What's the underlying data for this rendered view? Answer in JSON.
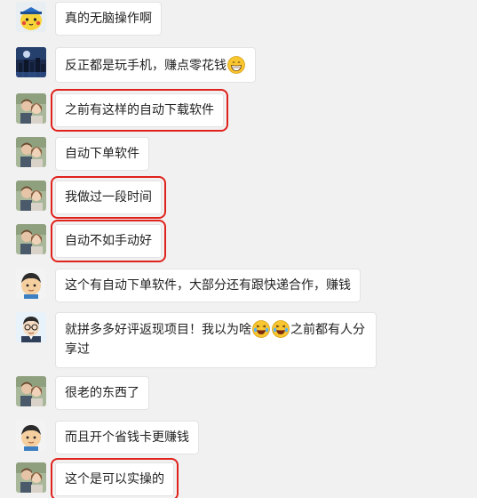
{
  "messages": [
    {
      "text": "真的无脑操作啊",
      "avatar": "pikachu-cap-avatar-icon",
      "highlighted": false
    },
    {
      "text": "反正都是玩手机，赚点零花钱",
      "avatar": "night-city-avatar-icon",
      "highlighted": false,
      "trailing_emoji": "grinning-face-emoji-icon"
    },
    {
      "text": "之前有这样的自动下载软件",
      "avatar": "couple-photo-avatar-icon",
      "highlighted": true
    },
    {
      "text": "自动下单软件",
      "avatar": "couple-photo-avatar-icon",
      "highlighted": false
    },
    {
      "text": "我做过一段时间",
      "avatar": "couple-photo-avatar-icon",
      "highlighted": true
    },
    {
      "text": "自动不如手动好",
      "avatar": "couple-photo-avatar-icon",
      "highlighted": true
    },
    {
      "text": "这个有自动下单软件，大部分还有跟快递合作，赚钱",
      "avatar": "cartoon-boy-avatar-icon",
      "highlighted": false
    },
    {
      "text_before": "就拼多多好评返现项目！我以为啥",
      "text_after": "之前都有人分享过",
      "avatar": "glasses-man-avatar-icon",
      "highlighted": false,
      "inline_emojis": [
        "laughing-tears-emoji-icon",
        "laughing-tears-emoji-icon"
      ]
    },
    {
      "text": "很老的东西了",
      "avatar": "couple-photo-avatar-icon",
      "highlighted": false
    },
    {
      "text": "而且开个省钱卡更赚钱",
      "avatar": "cartoon-boy-avatar-icon",
      "highlighted": false
    },
    {
      "text": "这个是可以实操的",
      "avatar": "couple-photo-avatar-icon",
      "highlighted": true
    }
  ],
  "colors": {
    "background": "#f1f1f1",
    "bubble": "#ffffff",
    "highlight_box": "#e0221c"
  }
}
